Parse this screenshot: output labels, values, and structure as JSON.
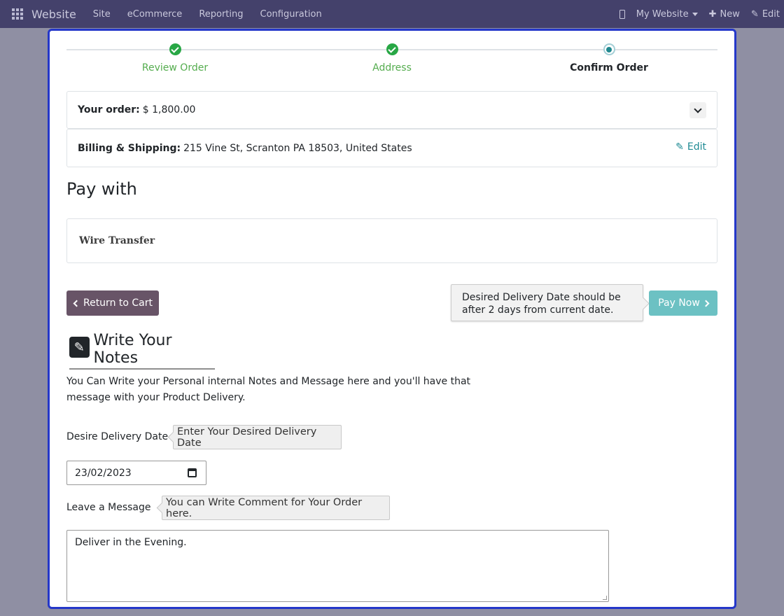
{
  "navbar": {
    "brand": "Website",
    "menu": [
      "Site",
      "eCommerce",
      "Reporting",
      "Configuration"
    ],
    "website_selector": "My Website",
    "new_label": "New",
    "edit_label": "Edit",
    "bg_color": "#44416b"
  },
  "wizard": {
    "steps": [
      {
        "label": "Review Order",
        "status": "done"
      },
      {
        "label": "Address",
        "status": "done"
      },
      {
        "label": "Confirm Order",
        "status": "current"
      }
    ]
  },
  "order": {
    "label": "Your order:",
    "amount": "$ 1,800.00"
  },
  "billing": {
    "label": "Billing & Shipping:",
    "address": "215 Vine St, Scranton PA 18503, United States",
    "edit_label": "Edit"
  },
  "payment": {
    "heading": "Pay with",
    "method": "Wire Transfer"
  },
  "actions": {
    "return_label": "Return to Cart",
    "pay_label": "Pay Now",
    "tooltip": "Desired Delivery Date should be after 2 days from current date.",
    "return_color": "#685467",
    "pay_color": "#6cc1c3"
  },
  "notes": {
    "title": "Write Your Notes",
    "description": "You Can Write your Personal internal Notes and Message here and you'll have that message with your Product Delivery.",
    "delivery_label": "Desire Delivery Date",
    "delivery_hint": "Enter Your Desired Delivery Date",
    "delivery_value": "23/02/2023",
    "message_label": "Leave a Message",
    "message_hint": "You can Write Comment for Your Order here.",
    "message_value": "Deliver in the Evening."
  },
  "accent_color": "#2437c9"
}
